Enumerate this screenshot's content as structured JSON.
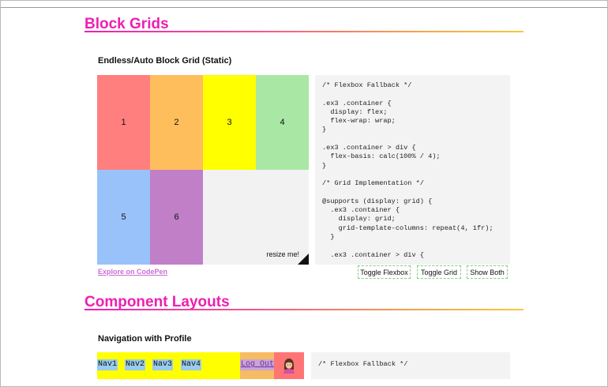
{
  "sections": {
    "block_grids": {
      "title": "Block Grids"
    },
    "component_layouts": {
      "title": "Component Layouts"
    }
  },
  "demo1": {
    "subtitle": "Endless/Auto Block Grid (Static)",
    "cells": [
      {
        "label": "1",
        "color": "#ff7f7f"
      },
      {
        "label": "2",
        "color": "#ffbe5c"
      },
      {
        "label": "3",
        "color": "#ffff00"
      },
      {
        "label": "4",
        "color": "#a8e8a4"
      },
      {
        "label": "5",
        "color": "#99c2fa"
      },
      {
        "label": "6",
        "color": "#c07fc7"
      }
    ],
    "resize_label": "resize me!",
    "code": "/* Flexbox Fallback */\n\n.ex3 .container {\n  display: flex;\n  flex-wrap: wrap;\n}\n\n.ex3 .container > div {\n  flex-basis: calc(100% / 4);\n}\n\n/* Grid Implementation */\n\n@supports (display: grid) {\n  .ex3 .container {\n    display: grid;\n    grid-template-columns: repeat(4, 1fr);\n  }\n\n  .ex3 .container > div {",
    "link": "Explore on CodePen",
    "buttons": {
      "toggle_flexbox": "Toggle Flexbox",
      "toggle_grid": "Toggle Grid",
      "show_both": "Show Both"
    }
  },
  "demo2": {
    "subtitle": "Navigation with Profile",
    "nav_items": [
      "Nav1",
      "Nav2",
      "Nav3",
      "Nav4"
    ],
    "logout": "Log Out",
    "code": "/* Flexbox Fallback */"
  },
  "colors": {
    "accent": "#ee1fb1",
    "nav_bg": "#ffff00",
    "nav_item_bg": "#99ccee",
    "button_border": "#7ed37e"
  }
}
